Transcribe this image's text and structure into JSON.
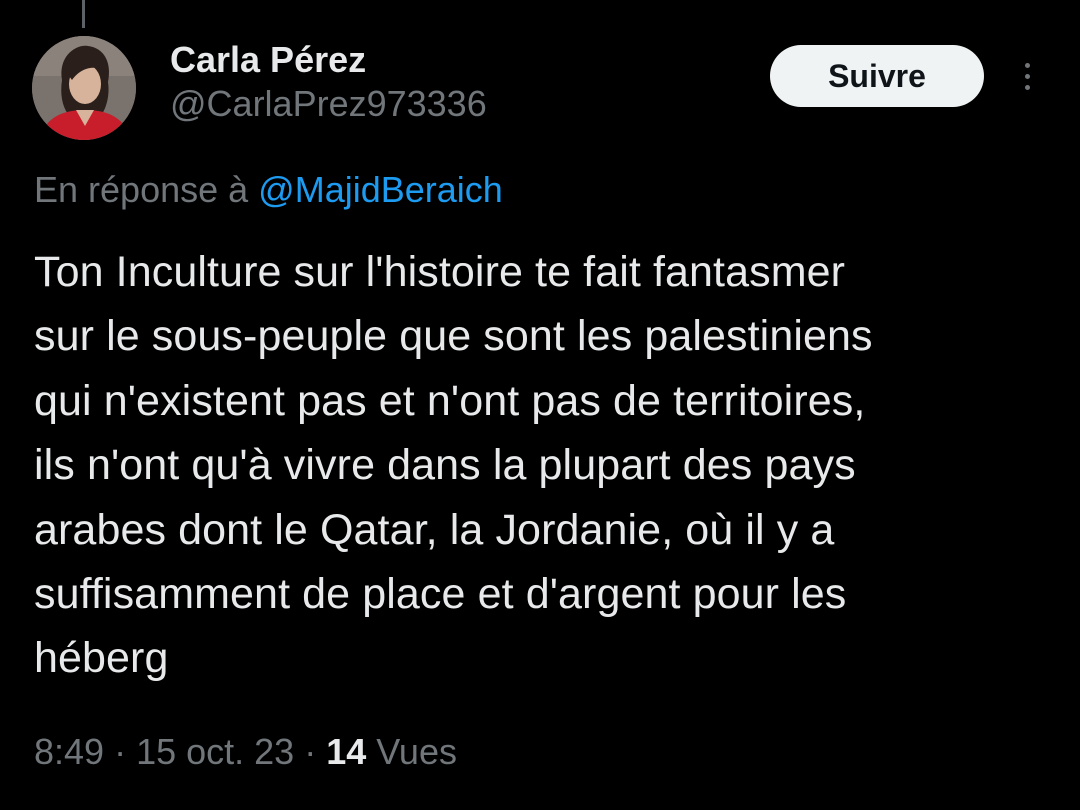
{
  "author": {
    "display_name": "Carla Pérez",
    "handle": "@CarlaPrez973336"
  },
  "actions": {
    "follow_label": "Suivre",
    "more_icon": "more-vertical-icon"
  },
  "reply": {
    "prefix": "En réponse à ",
    "mention": "@MajidBeraich"
  },
  "tweet": {
    "text": "Ton Inculture sur l'histoire te fait fantasmer\nsur le sous-peuple que sont les palestiniens\nqui n'existent pas et n'ont pas de territoires,\nils n'ont qu'à vivre dans la plupart des pays\narabes dont le Qatar, la Jordanie, où il y a\nsuffisamment de place et d'argent pour les\nhéberg"
  },
  "meta": {
    "time": "8:49",
    "separator": " · ",
    "date": "15 oct. 23",
    "views_count": "14",
    "views_label": " Vues"
  },
  "colors": {
    "background": "#000000",
    "primary_text": "#e7e9ea",
    "secondary_text": "#71767b",
    "link": "#1d9bf0",
    "button_bg": "#eff3f4"
  }
}
